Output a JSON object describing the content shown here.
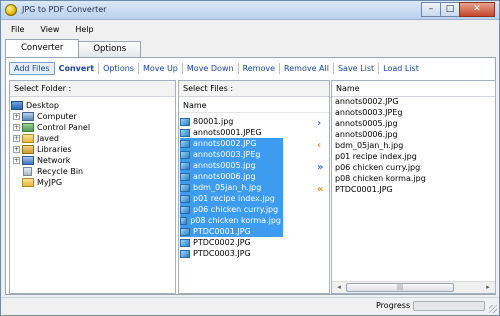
{
  "window": {
    "title": "JPG to PDF Converter",
    "minimize": "–",
    "maximize": "□",
    "close": "✕"
  },
  "menu": [
    "File",
    "View",
    "Help"
  ],
  "tabs": [
    "Converter",
    "Options"
  ],
  "toolbar": [
    "Add Files",
    "Convert",
    "Options",
    "Move Up",
    "Move Down",
    "Remove",
    "Remove All",
    "Save List",
    "Load List"
  ],
  "folder_pane": {
    "header": "Select Folder :",
    "items": [
      {
        "label": "Desktop",
        "expander": "",
        "icon": "desktop-icon"
      },
      {
        "label": "Computer",
        "expander": "+",
        "icon": "computer-icon"
      },
      {
        "label": "Control Panel",
        "expander": "+",
        "icon": "control-panel-icon"
      },
      {
        "label": "Javed",
        "expander": "+",
        "icon": "folder-icon"
      },
      {
        "label": "Libraries",
        "expander": "+",
        "icon": "library-icon"
      },
      {
        "label": "Network",
        "expander": "+",
        "icon": "network-icon"
      },
      {
        "label": "Recycle Bin",
        "expander": "",
        "icon": "recycle-bin-icon"
      },
      {
        "label": "MyJPG",
        "expander": "",
        "icon": "folder-icon"
      }
    ]
  },
  "files_pane": {
    "header": "Select Files :",
    "column": "Name",
    "files": [
      {
        "name": "80001.jpg",
        "selected": false
      },
      {
        "name": "annots0001.JPEG",
        "selected": false
      },
      {
        "name": "annots0002.JPG",
        "selected": true
      },
      {
        "name": "annots0003.JPEg",
        "selected": true
      },
      {
        "name": "annots0005.jpg",
        "selected": true
      },
      {
        "name": "annots0006.jpg",
        "selected": true
      },
      {
        "name": "bdm_05jan_h.jpg",
        "selected": true
      },
      {
        "name": "p01 recipe index.jpg",
        "selected": true
      },
      {
        "name": "p06 chicken curry.jpg",
        "selected": true
      },
      {
        "name": "p08 chicken korma.jpg",
        "selected": true
      },
      {
        "name": "PTDC0001.JPG",
        "selected": true
      },
      {
        "name": "PTDC0002.JPG",
        "selected": false
      },
      {
        "name": "PTDC0003.JPG",
        "selected": false
      }
    ]
  },
  "transfer_buttons": [
    {
      "glyph": "›",
      "icon": "add-selected-icon",
      "color": "blue"
    },
    {
      "glyph": "‹",
      "icon": "remove-selected-icon",
      "color": "orange"
    },
    {
      "glyph": "»",
      "icon": "add-all-icon",
      "color": "blue"
    },
    {
      "glyph": "«",
      "icon": "remove-all-icon",
      "color": "orange"
    }
  ],
  "output_pane": {
    "column": "Name",
    "files": [
      "annots0002.JPG",
      "annots0003.JPEg",
      "annots0005.jpg",
      "annots0006.jpg",
      "bdm_05jan_h.jpg",
      "p01 recipe index.jpg",
      "p06 chicken curry.jpg",
      "p08 chicken korma.jpg",
      "PTDC0001.JPG"
    ],
    "scroll_left": "◂",
    "scroll_right": "▸",
    "scroll_grip": "|||"
  },
  "status": {
    "label": "Progress",
    "progress": 0
  },
  "colors": {
    "selection": "#3d9bf0",
    "link": "#1646a6",
    "progress": "#2ecc40"
  }
}
